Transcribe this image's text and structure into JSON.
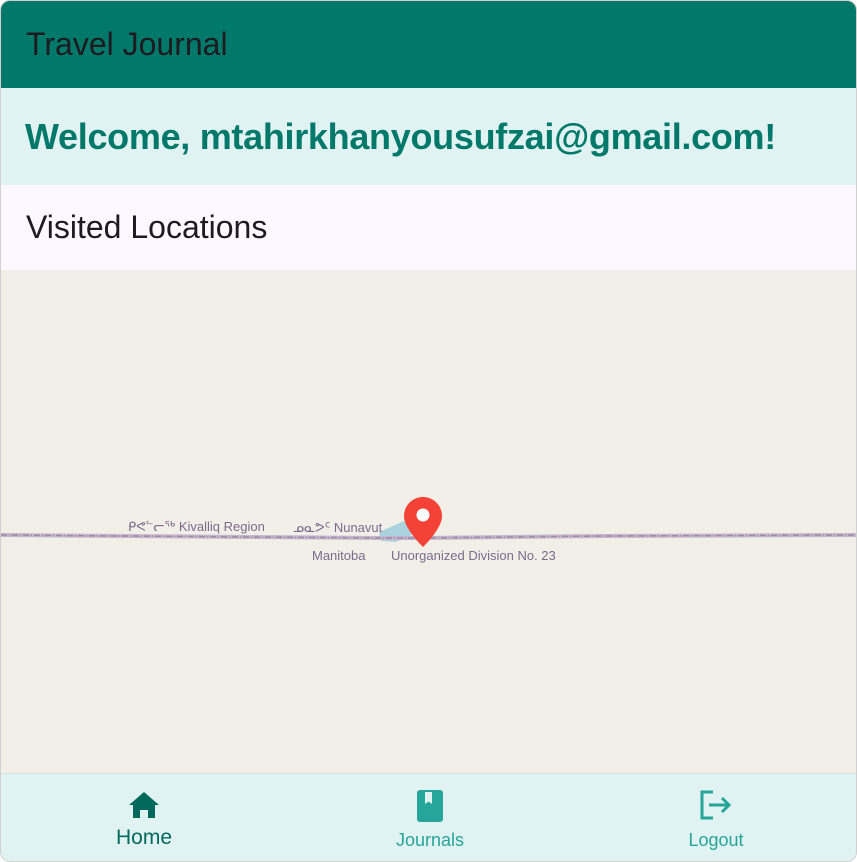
{
  "appbar": {
    "title": "Travel Journal"
  },
  "welcome": {
    "text": "Welcome, mtahirkhanyousufzai@gmail.com!"
  },
  "section": {
    "title": "Visited Locations"
  },
  "map": {
    "labels": {
      "kivalliq": "ᑭᕙᓪᓕᖅ Kivalliq Region",
      "nunavut": "ᓄᓇᕗᑦ Nunavut",
      "manitoba": "Manitoba",
      "division": "Unorganized Division No. 23"
    },
    "marker_color": "#f44336",
    "border_color": "#9d8aa8",
    "water_color": "#aad3df"
  },
  "bottom_nav": {
    "items": [
      {
        "label": "Home",
        "icon": "home-icon",
        "selected": true
      },
      {
        "label": "Journals",
        "icon": "book-icon",
        "selected": false
      },
      {
        "label": "Logout",
        "icon": "logout-icon",
        "selected": false
      }
    ]
  },
  "colors": {
    "primary": "#00796b",
    "primary_light": "#e0f2f1",
    "accent": "#26a69a"
  }
}
